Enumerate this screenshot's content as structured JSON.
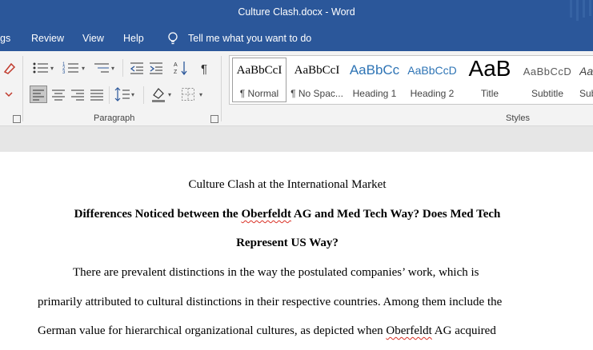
{
  "window": {
    "title": "Culture Clash.docx  -  Word"
  },
  "menu": {
    "items": [
      "gs",
      "Review",
      "View",
      "Help"
    ],
    "tell_me": "Tell me what you want to do"
  },
  "ribbon": {
    "paragraph_label": "Paragraph",
    "styles_label": "Styles",
    "styles": [
      {
        "sample": "AaBbCcI",
        "name": "¶ Normal",
        "color": "#000000"
      },
      {
        "sample": "AaBbCcI",
        "name": "¶ No Spac...",
        "color": "#000000"
      },
      {
        "sample": "AaBbCc",
        "name": "Heading 1",
        "color": "#2e74b5"
      },
      {
        "sample": "AaBbCcD",
        "name": "Heading 2",
        "color": "#2e74b5"
      },
      {
        "sample": "AaB",
        "name": "Title",
        "color": "#000000"
      },
      {
        "sample": "AaBbCcD",
        "name": "Subtitle",
        "color": "#595959"
      },
      {
        "sample": "AaBbC",
        "name": "Sub",
        "color": "#404040"
      }
    ]
  },
  "document": {
    "title": "Culture Clash at the International Market",
    "heading_line1_a": "Differences Noticed between the ",
    "heading_line1_b": "Oberfeldt",
    "heading_line1_c": " AG and Med Tech Way? Does Med Tech",
    "heading_line2": "Represent US Way?",
    "para_line1": "There are prevalent distinctions in the way the postulated companies’ work, which is",
    "para_line2": "primarily attributed to cultural distinctions in their respective countries. Among them include the",
    "para_line3_a": "German value for hierarchical organizational cultures, as depicted when ",
    "para_line3_b": "Oberfeldt",
    "para_line3_c": " AG acquired"
  }
}
